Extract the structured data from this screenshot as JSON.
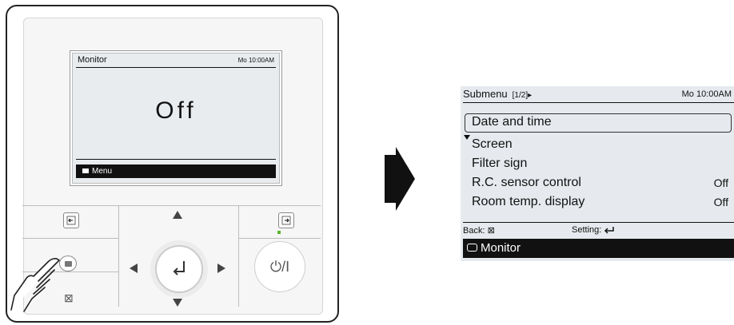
{
  "remote": {
    "screen": {
      "title": "Monitor",
      "clock": "Mo 10:00AM",
      "status": "Off",
      "menu_label": "Menu"
    },
    "power_label": "⏻/I"
  },
  "submenu": {
    "title": "Submenu",
    "page": "[1/2]▸",
    "clock": "Mo 10:00AM",
    "items": [
      {
        "label": "Date and time",
        "value": ""
      },
      {
        "label": "Screen",
        "value": ""
      },
      {
        "label": "Filter sign",
        "value": ""
      },
      {
        "label": "R.C. sensor control",
        "value": "Off"
      },
      {
        "label": "Room temp. display",
        "value": "Off"
      }
    ],
    "back_label": "Back:",
    "setting_label": "Setting:",
    "bottom_label": "Monitor"
  }
}
